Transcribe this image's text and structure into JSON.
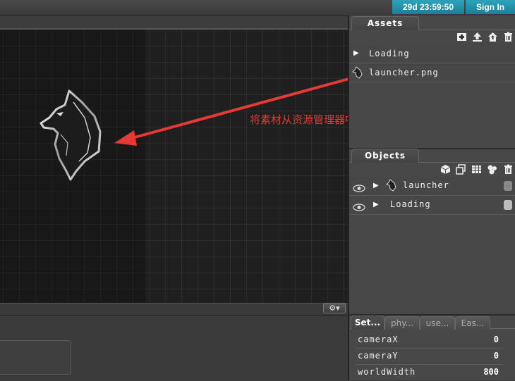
{
  "topbar": {
    "timer": "29d 23:59:50",
    "signin": "Sign In"
  },
  "annotation": {
    "text": "将素材从资源管理器中拖拽到地图编辑器上",
    "color": "#e53935"
  },
  "canvas": {
    "sprite": "wolf-head-sprite",
    "settings_icon": "gear-icon"
  },
  "assets_panel": {
    "tab_label": "Assets",
    "toolbar_icons": [
      "add-folder-icon",
      "upload-icon",
      "home-upload-icon",
      "trash-icon"
    ],
    "items": [
      {
        "label": "Loading",
        "icon": "expand-triangle-icon"
      },
      {
        "label": "launcher.png",
        "icon": "wolf-thumbnail-icon"
      }
    ]
  },
  "objects_panel": {
    "tab_label": "Objects",
    "toolbar_icons": [
      "cube-icon",
      "copy-icon",
      "grid-icon",
      "group-icon",
      "trash-icon"
    ],
    "items": [
      {
        "label": "launcher",
        "visible_icon": "eye-icon",
        "lock_icon": "lock-icon"
      },
      {
        "label": "Loading",
        "visible_icon": "eye-icon",
        "lock_icon": "lock-icon"
      }
    ]
  },
  "properties_panel": {
    "tabs": [
      "Set...",
      "phy...",
      "use...",
      "Eas..."
    ],
    "rows": [
      {
        "label": "cameraX",
        "value": "0"
      },
      {
        "label": "cameraY",
        "value": "0"
      },
      {
        "label": "worldWidth",
        "value": "800"
      }
    ]
  }
}
